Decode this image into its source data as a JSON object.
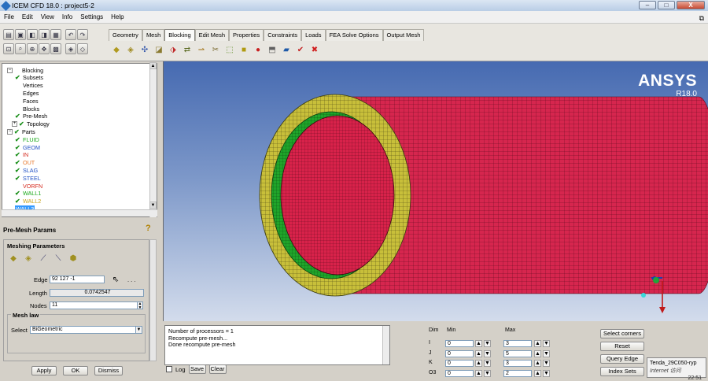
{
  "window": {
    "title": "ICEM CFD 18.0 : project5-2",
    "controls": {
      "minimize": "–",
      "maximize": "□",
      "close": "X"
    },
    "restore": "⧉"
  },
  "menu": [
    "File",
    "Edit",
    "View",
    "Info",
    "Settings",
    "Help"
  ],
  "tabs": [
    "Geometry",
    "Mesh",
    "Blocking",
    "Edit Mesh",
    "Properties",
    "Constraints",
    "Loads",
    "FEA Solve Options",
    "Output Mesh"
  ],
  "active_tab": "Blocking",
  "tree": {
    "items": [
      {
        "label": "Blocking",
        "color": "#000000",
        "checked": false
      },
      {
        "label": "Subsets",
        "color": "#000000",
        "checked": true
      },
      {
        "label": "Vertices",
        "color": "#000000",
        "checked": false
      },
      {
        "label": "Edges",
        "color": "#000000",
        "checked": false
      },
      {
        "label": "Faces",
        "color": "#000000",
        "checked": false
      },
      {
        "label": "Blocks",
        "color": "#000000",
        "checked": false
      },
      {
        "label": "Pre-Mesh",
        "color": "#000000",
        "checked": true
      },
      {
        "label": "Topology",
        "color": "#000000",
        "checked": true
      },
      {
        "label": "Parts",
        "color": "#000000",
        "checked": true
      },
      {
        "label": "FLUID",
        "color": "#18a818",
        "checked": true
      },
      {
        "label": "GEOM",
        "color": "#1f4fc4",
        "checked": true
      },
      {
        "label": "IN",
        "color": "#d4261a",
        "checked": true
      },
      {
        "label": "OUT",
        "color": "#e8772a",
        "checked": true
      },
      {
        "label": "SLAG",
        "color": "#1f4fc4",
        "checked": true
      },
      {
        "label": "STEEL",
        "color": "#1f4fc4",
        "checked": true
      },
      {
        "label": "VORFN",
        "color": "#d4261a",
        "checked": false
      },
      {
        "label": "WALL1",
        "color": "#18a818",
        "checked": true
      },
      {
        "label": "WALL2",
        "color": "#c8a21a",
        "checked": true
      },
      {
        "label": "WALL3",
        "color": "#ffffff",
        "checked": true
      }
    ]
  },
  "premesh": {
    "title": "Pre-Mesh Params",
    "section": "Meshing Parameters",
    "edge_label": "Edge",
    "edge_value": "92 127 -1",
    "ellipsis": ". . .",
    "length_label": "Length",
    "length_value": "0.0742547",
    "nodes_label": "Nodes",
    "nodes_value": "11",
    "meshlaw_label": "Mesh law",
    "select_label": "Select",
    "select_value": "BiGeometric",
    "apply": "Apply",
    "ok": "OK",
    "dismiss": "Dismiss"
  },
  "viewport": {
    "brand": "ANSYS",
    "version": "R18.0"
  },
  "messages": {
    "lines": [
      "Number of processors = 1",
      "Recompute pre-mesh...",
      "Done recompute pre-mesh"
    ],
    "log_label": "Log",
    "save": "Save",
    "clear": "Clear"
  },
  "dims": {
    "headers": {
      "dim": "Dim",
      "min": "Min",
      "max": "Max"
    },
    "rows": [
      {
        "dim": "I",
        "min": "0",
        "max": "3"
      },
      {
        "dim": "J",
        "min": "0",
        "max": "5"
      },
      {
        "dim": "K",
        "min": "0",
        "max": "3"
      },
      {
        "dim": "O3",
        "min": "0",
        "max": "2"
      }
    ]
  },
  "actions": [
    "Select corners",
    "Reset",
    "Query Edge",
    "Index Sets"
  ],
  "tooltip": {
    "line1": "Tenda_29C050-ryp",
    "line2": "Internet 访问"
  },
  "clock": "22:51"
}
